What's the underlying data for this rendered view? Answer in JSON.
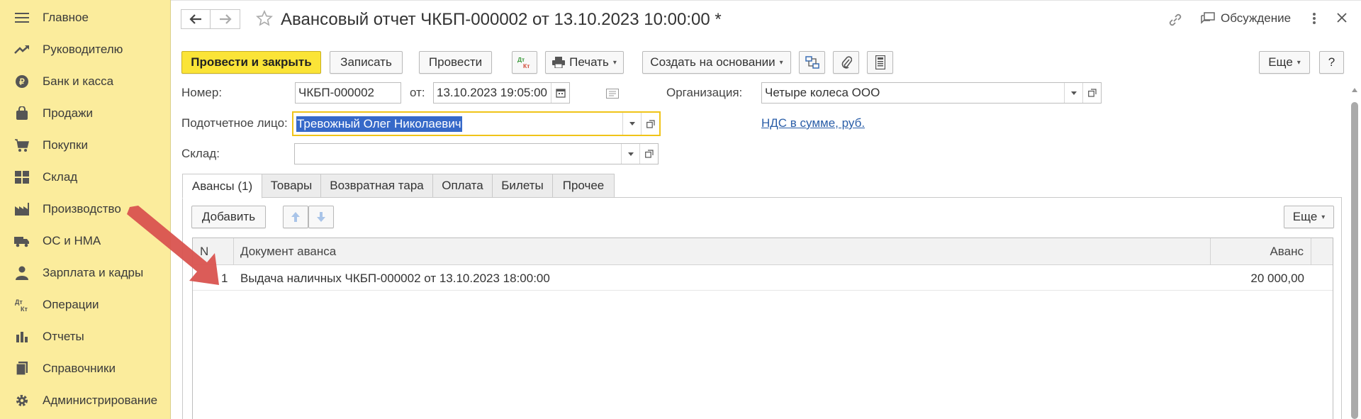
{
  "sidebar": {
    "items": [
      {
        "label": "Главное",
        "icon": "menu-icon"
      },
      {
        "label": "Руководителю",
        "icon": "trend-icon"
      },
      {
        "label": "Банк и касса",
        "icon": "coin-icon"
      },
      {
        "label": "Продажи",
        "icon": "shopping-bag-icon"
      },
      {
        "label": "Покупки",
        "icon": "cart-icon"
      },
      {
        "label": "Склад",
        "icon": "warehouse-icon"
      },
      {
        "label": "Производство",
        "icon": "factory-icon"
      },
      {
        "label": "ОС и НМА",
        "icon": "truck-icon"
      },
      {
        "label": "Зарплата и кадры",
        "icon": "person-icon"
      },
      {
        "label": "Операции",
        "icon": "dt-kt-icon"
      },
      {
        "label": "Отчеты",
        "icon": "bar-chart-icon"
      },
      {
        "label": "Справочники",
        "icon": "books-icon"
      },
      {
        "label": "Администрирование",
        "icon": "gear-icon"
      }
    ]
  },
  "header": {
    "title": "Авансовый отчет ЧКБП-000002 от 13.10.2023 10:00:00 *",
    "discussion": "Обсуждение"
  },
  "toolbar": {
    "post_close": "Провести и закрыть",
    "save": "Записать",
    "post": "Провести",
    "dtkt": "Дт Кт",
    "print": "Печать",
    "create_based": "Создать на основании",
    "more": "Еще",
    "help": "?"
  },
  "form": {
    "number_label": "Номер:",
    "number_value": "ЧКБП-000002",
    "date_label": "от:",
    "date_value": "13.10.2023 19:05:00",
    "org_label": "Организация:",
    "org_value": "Четыре колеса ООО",
    "person_label": "Подотчетное лицо:",
    "person_value": "Тревожный Олег Николаевич",
    "vat_link": "НДС в сумме, руб.",
    "warehouse_label": "Склад:",
    "warehouse_value": ""
  },
  "tabs": [
    {
      "label": "Авансы (1)",
      "active": true
    },
    {
      "label": "Товары",
      "active": false
    },
    {
      "label": "Возвратная тара",
      "active": false
    },
    {
      "label": "Оплата",
      "active": false
    },
    {
      "label": "Билеты",
      "active": false
    },
    {
      "label": "Прочее",
      "active": false
    }
  ],
  "table_toolbar": {
    "add": "Добавить",
    "more": "Еще"
  },
  "table": {
    "columns": [
      "N",
      "Документ аванса",
      "Аванс"
    ],
    "rows": [
      {
        "n": "1",
        "document": "Выдача наличных ЧКБП-000002 от 13.10.2023 18:00:00",
        "amount": "20 000,00"
      }
    ]
  },
  "colors": {
    "sidebar_bg": "#fbec9c",
    "primary_button": "#fbe437",
    "annotation_arrow": "#d9534f",
    "selection": "#3669c9"
  }
}
